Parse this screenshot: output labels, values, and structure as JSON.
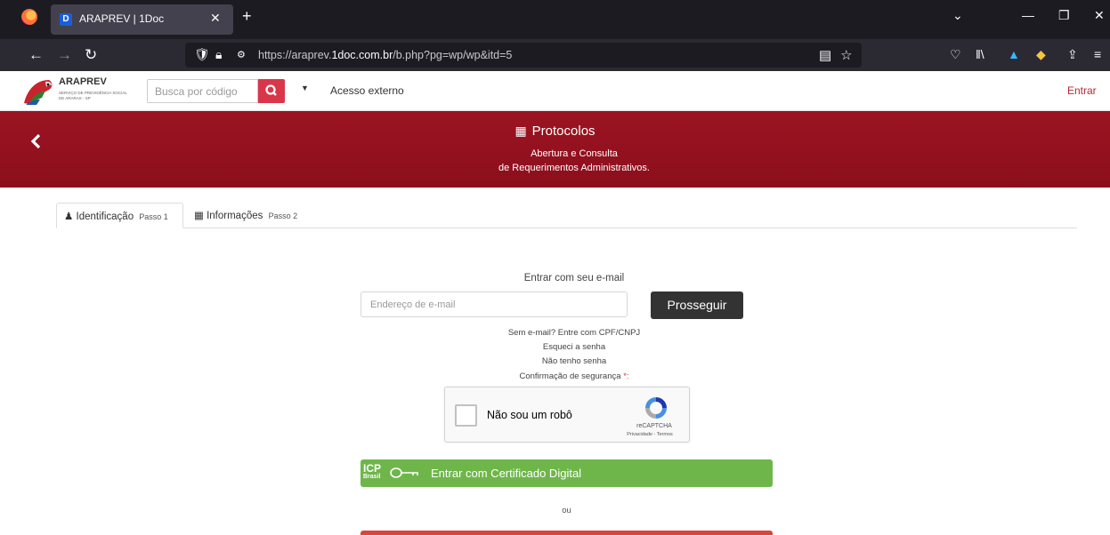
{
  "browser": {
    "tab_title": "ARAPREV | 1Doc",
    "tab_favicon": "D",
    "url_prefix": "https://araprev.",
    "url_host": "1doc.com.br",
    "url_path": "/b.php?pg=wp/wp&itd=5",
    "icons": [
      "firefox-icon",
      "back-icon",
      "forward-icon",
      "reload-icon",
      "shield-icon",
      "lock-icon",
      "permissions-icon",
      "reader-icon",
      "star-icon",
      "pocket-icon",
      "library-icon",
      "extension-icon",
      "share-icon",
      "menu-icon"
    ]
  },
  "header": {
    "logo_title": "ARAPREV",
    "logo_subtitle": "SERVIÇO DE PREVIDÊNCIA SOCIAL DE ARARAS - SP",
    "search_placeholder": "Busca por código",
    "external_access": "Acesso externo",
    "login": "Entrar"
  },
  "banner": {
    "title": "Protocolos",
    "subtitle_line1": "Abertura e Consulta",
    "subtitle_line2": "de Requerimentos Administrativos."
  },
  "steps": [
    {
      "label": "Identificação",
      "step": "Passo 1"
    },
    {
      "label": "Informações",
      "step": "Passo 2"
    }
  ],
  "login": {
    "title": "Entrar com seu e-mail",
    "email_placeholder": "Endereço de e-mail",
    "submit": "Prosseguir",
    "no_email": "Sem e-mail? Entre com CPF/CNPJ",
    "forgot": "Esqueci a senha",
    "no_password": "Não tenho senha",
    "security": "Confirmação de segurança",
    "required_mark": "*:"
  },
  "captcha": {
    "label": "Não sou um robô",
    "brand": "reCAPTCHA",
    "links": "Privacidade - Termos"
  },
  "certificate": {
    "logo_top": "ICP",
    "logo_bottom": "Brasil",
    "label": "Entrar com Certificado Digital"
  },
  "separator": "ou",
  "colors": {
    "brand_red": "#8c0f1c",
    "accent_red": "#d9364a",
    "green": "#6fb64a",
    "dark_button": "#333333"
  }
}
